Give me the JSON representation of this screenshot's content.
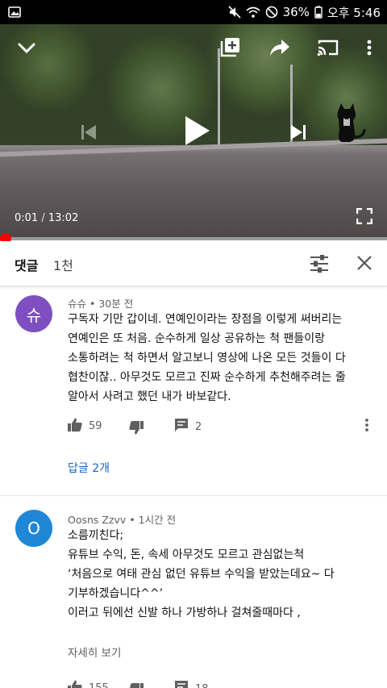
{
  "status_bar": {
    "battery": "36%",
    "time": "오후 5:46",
    "icons": [
      "image-icon",
      "mute-icon",
      "wifi-icon",
      "dnd-icon",
      "battery-icon"
    ]
  },
  "player": {
    "current_time": "0:01",
    "separator": "/",
    "duration": "13:02",
    "progress_fraction": 0.0013,
    "icons": [
      "chevron-down-icon",
      "add-to-playlist-icon",
      "share-icon",
      "cast-icon",
      "more-vert-icon",
      "previous-icon",
      "play-icon",
      "next-icon",
      "fullscreen-icon"
    ]
  },
  "comments_header": {
    "title": "댓글",
    "count": "1천"
  },
  "comments": [
    {
      "avatar_letter": "슈",
      "avatar_color": "#7e4fc0",
      "author": "슈슈",
      "time": "30분 전",
      "text": "구독자 기만 갑이네. 연예인이라는 장점을 이렇게 써버리는\n연예인은 또 처음. 순수하게 일상 공유하는 척 팬들이랑\n소통하려는 척 하면서 알고보니 영상에 나온 모든 것들이 다\n협찬이잖.. 아무것도 모르고 진짜 순수하게 추천해주려는 줄\n알아서 사려고 했던 내가 바보같다.",
      "likes": "59",
      "replies_count": "2",
      "replies_link": "답글 2개"
    },
    {
      "avatar_letter": "O",
      "avatar_color": "#1f87d6",
      "author": "Oosns Zzvv",
      "time": "1시간 전",
      "text": "소름끼친다;\n유튜브 수익, 돈, 속세 아무것도 모르고 관심없는척\n‘처음으로 여태 관심 없던 유튜브 수익을 받았는데요~ 다\n기부하겠습니다^^’\n이러고 뒤에선 신발 하나 가방하나 걸쳐줄때마다 ,",
      "more_link": "자세히 보기",
      "likes": "155",
      "replies_count": "18"
    }
  ],
  "colors": {
    "accent_red": "#ff0000",
    "link_blue": "#1a63c7"
  }
}
